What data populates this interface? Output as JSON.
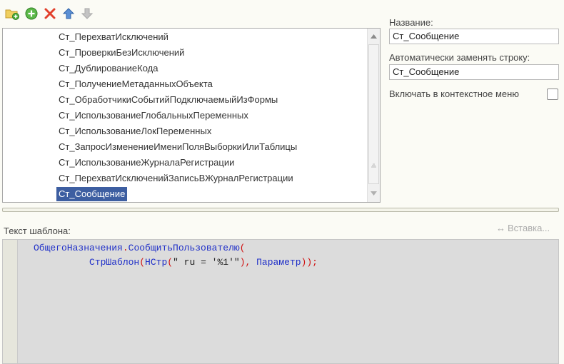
{
  "toolbar": {
    "buttons": [
      {
        "name": "add-group-button",
        "icon": "folder-add-icon"
      },
      {
        "name": "add-item-button",
        "icon": "plus-circle-icon"
      },
      {
        "name": "delete-button",
        "icon": "red-x-icon"
      },
      {
        "name": "move-up-button",
        "icon": "arrow-up-icon"
      },
      {
        "name": "move-down-button",
        "icon": "arrow-down-icon"
      }
    ]
  },
  "tree": {
    "items": [
      "Ст_ПерехватИсключений",
      "Ст_ПроверкиБезИсключений",
      "Ст_ДублированиеКода",
      "Ст_ПолучениеМетаданныхОбъекта",
      "Ст_ОбработчикиСобытийПодключаемыйИзФормы",
      "Ст_ИспользованиеГлобальныхПеременных",
      "Ст_ИспользованиеЛокПеременных",
      "Ст_ЗапросИзменениеИмениПоляВыборкиИлиТаблицы",
      "Ст_ИспользованиеЖурналаРегистрации",
      "Ст_ПерехватИсключенийЗаписьВЖурналРегистрации",
      "Ст_Сообщение"
    ],
    "selected_index": 10
  },
  "form": {
    "name_label": "Название:",
    "name_value": "Ст_Сообщение",
    "replace_label": "Автоматически заменять строку:",
    "replace_value": "Ст_Сообщение",
    "context_menu_label": "Включать в контекстное меню",
    "context_menu_checked": false
  },
  "template": {
    "label": "Текст шаблона:",
    "insert_label": "Вставка..."
  },
  "code": {
    "line1": {
      "module": "ОбщегоНазначения",
      "dot": ".",
      "method": "СообщитьПользователю",
      "paren": "("
    },
    "line2": {
      "indent": "          ",
      "func": "СтрШаблон",
      "p1": "(",
      "func2": "НСтр",
      "p2": "(",
      "string": "\" ru = '%1'\"",
      "p3": "),",
      "space": " ",
      "param": "Параметр",
      "p4": "));"
    }
  },
  "colors": {
    "selection": "#3d5ea1",
    "code_keyword": "#1f2fc8",
    "code_operator": "#d01010"
  }
}
